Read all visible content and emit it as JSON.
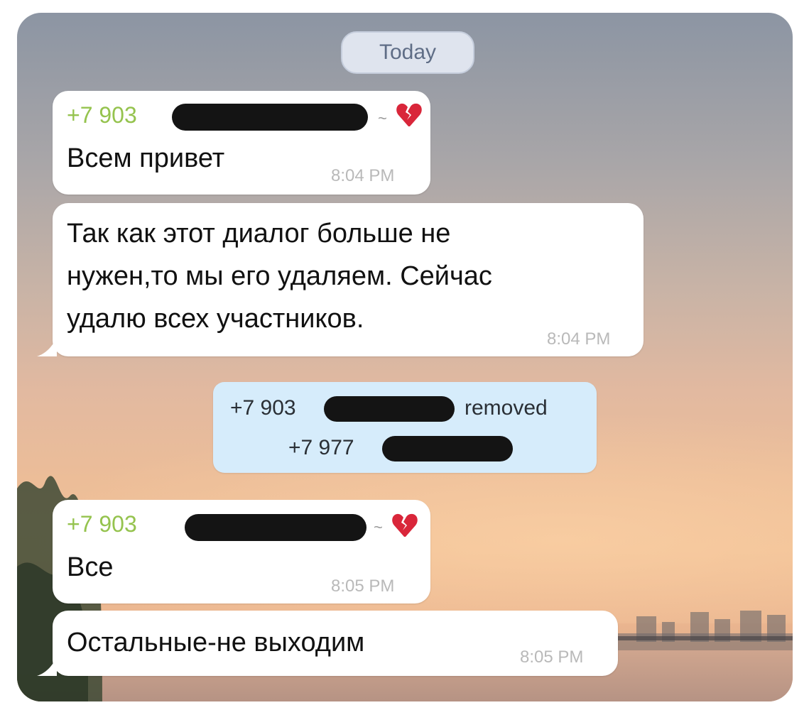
{
  "chat": {
    "date_label": "Today",
    "messages": [
      {
        "sender": "+7 903",
        "text": "Всем привет",
        "time": "8:04 PM"
      },
      {
        "lines": [
          "Так как этот диалог больше не",
          "нужен,то мы его удаляем. Сейчас",
          "удалю всех участников."
        ],
        "time": "8:04 PM"
      },
      {
        "sender": "+7 903",
        "text": "Все",
        "time": "8:05 PM"
      },
      {
        "text": "Остальные-не выходим",
        "time": "8:05 PM"
      }
    ],
    "system_notice": {
      "actor": "+7 903",
      "action": "removed",
      "target": "+7 977"
    },
    "sender_status": {
      "separator": "~",
      "icon": "broken-heart-icon"
    }
  },
  "colors": {
    "sender_name": "#95c34e",
    "bubble": "#ffffff",
    "system_bubble": "#d6ecfb",
    "date_pill": "#dfe4ee",
    "time": "#b9b9b9"
  }
}
